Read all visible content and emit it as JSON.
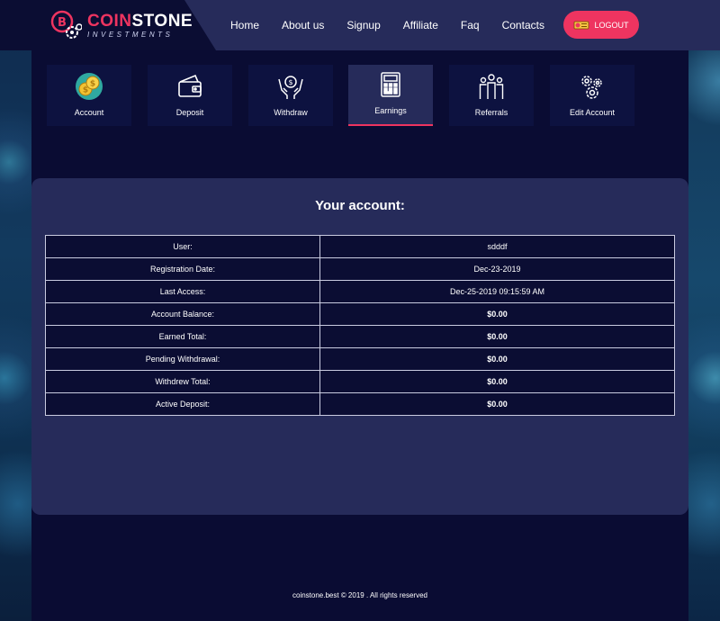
{
  "brand": {
    "title_part1": "COIN",
    "title_part2": "STONE",
    "subtitle": "INVESTMENTS",
    "accent_color": "#ee3460"
  },
  "nav": {
    "items": [
      {
        "label": "Home"
      },
      {
        "label": "About us"
      },
      {
        "label": "Signup"
      },
      {
        "label": "Affiliate"
      },
      {
        "label": "Faq"
      },
      {
        "label": "Contacts"
      }
    ],
    "logout_label": "LOGOUT"
  },
  "tiles": [
    {
      "label": "Account",
      "icon": "coins-icon"
    },
    {
      "label": "Deposit",
      "icon": "wallet-icon"
    },
    {
      "label": "Withdraw",
      "icon": "hands-coin-icon"
    },
    {
      "label": "Earnings",
      "icon": "calculator-icon",
      "active": true
    },
    {
      "label": "Referrals",
      "icon": "people-icon"
    },
    {
      "label": "Edit Account",
      "icon": "gears-icon"
    }
  ],
  "account": {
    "heading": "Your account:",
    "rows": [
      {
        "key": "User:",
        "value": "sdddf"
      },
      {
        "key": "Registration Date:",
        "value": "Dec-23-2019"
      },
      {
        "key": "Last Access:",
        "value": "Dec-25-2019 09:15:59 AM"
      },
      {
        "key": "Account Balance:",
        "value": "$0.00"
      },
      {
        "key": "Earned Total:",
        "value": "$0.00"
      },
      {
        "key": "Pending Withdrawal:",
        "value": "$0.00"
      },
      {
        "key": "Withdrew Total:",
        "value": "$0.00"
      },
      {
        "key": "Active Deposit:",
        "value": "$0.00"
      }
    ]
  },
  "footer": {
    "text": "coinstone.best © 2019 . All rights reserved"
  }
}
